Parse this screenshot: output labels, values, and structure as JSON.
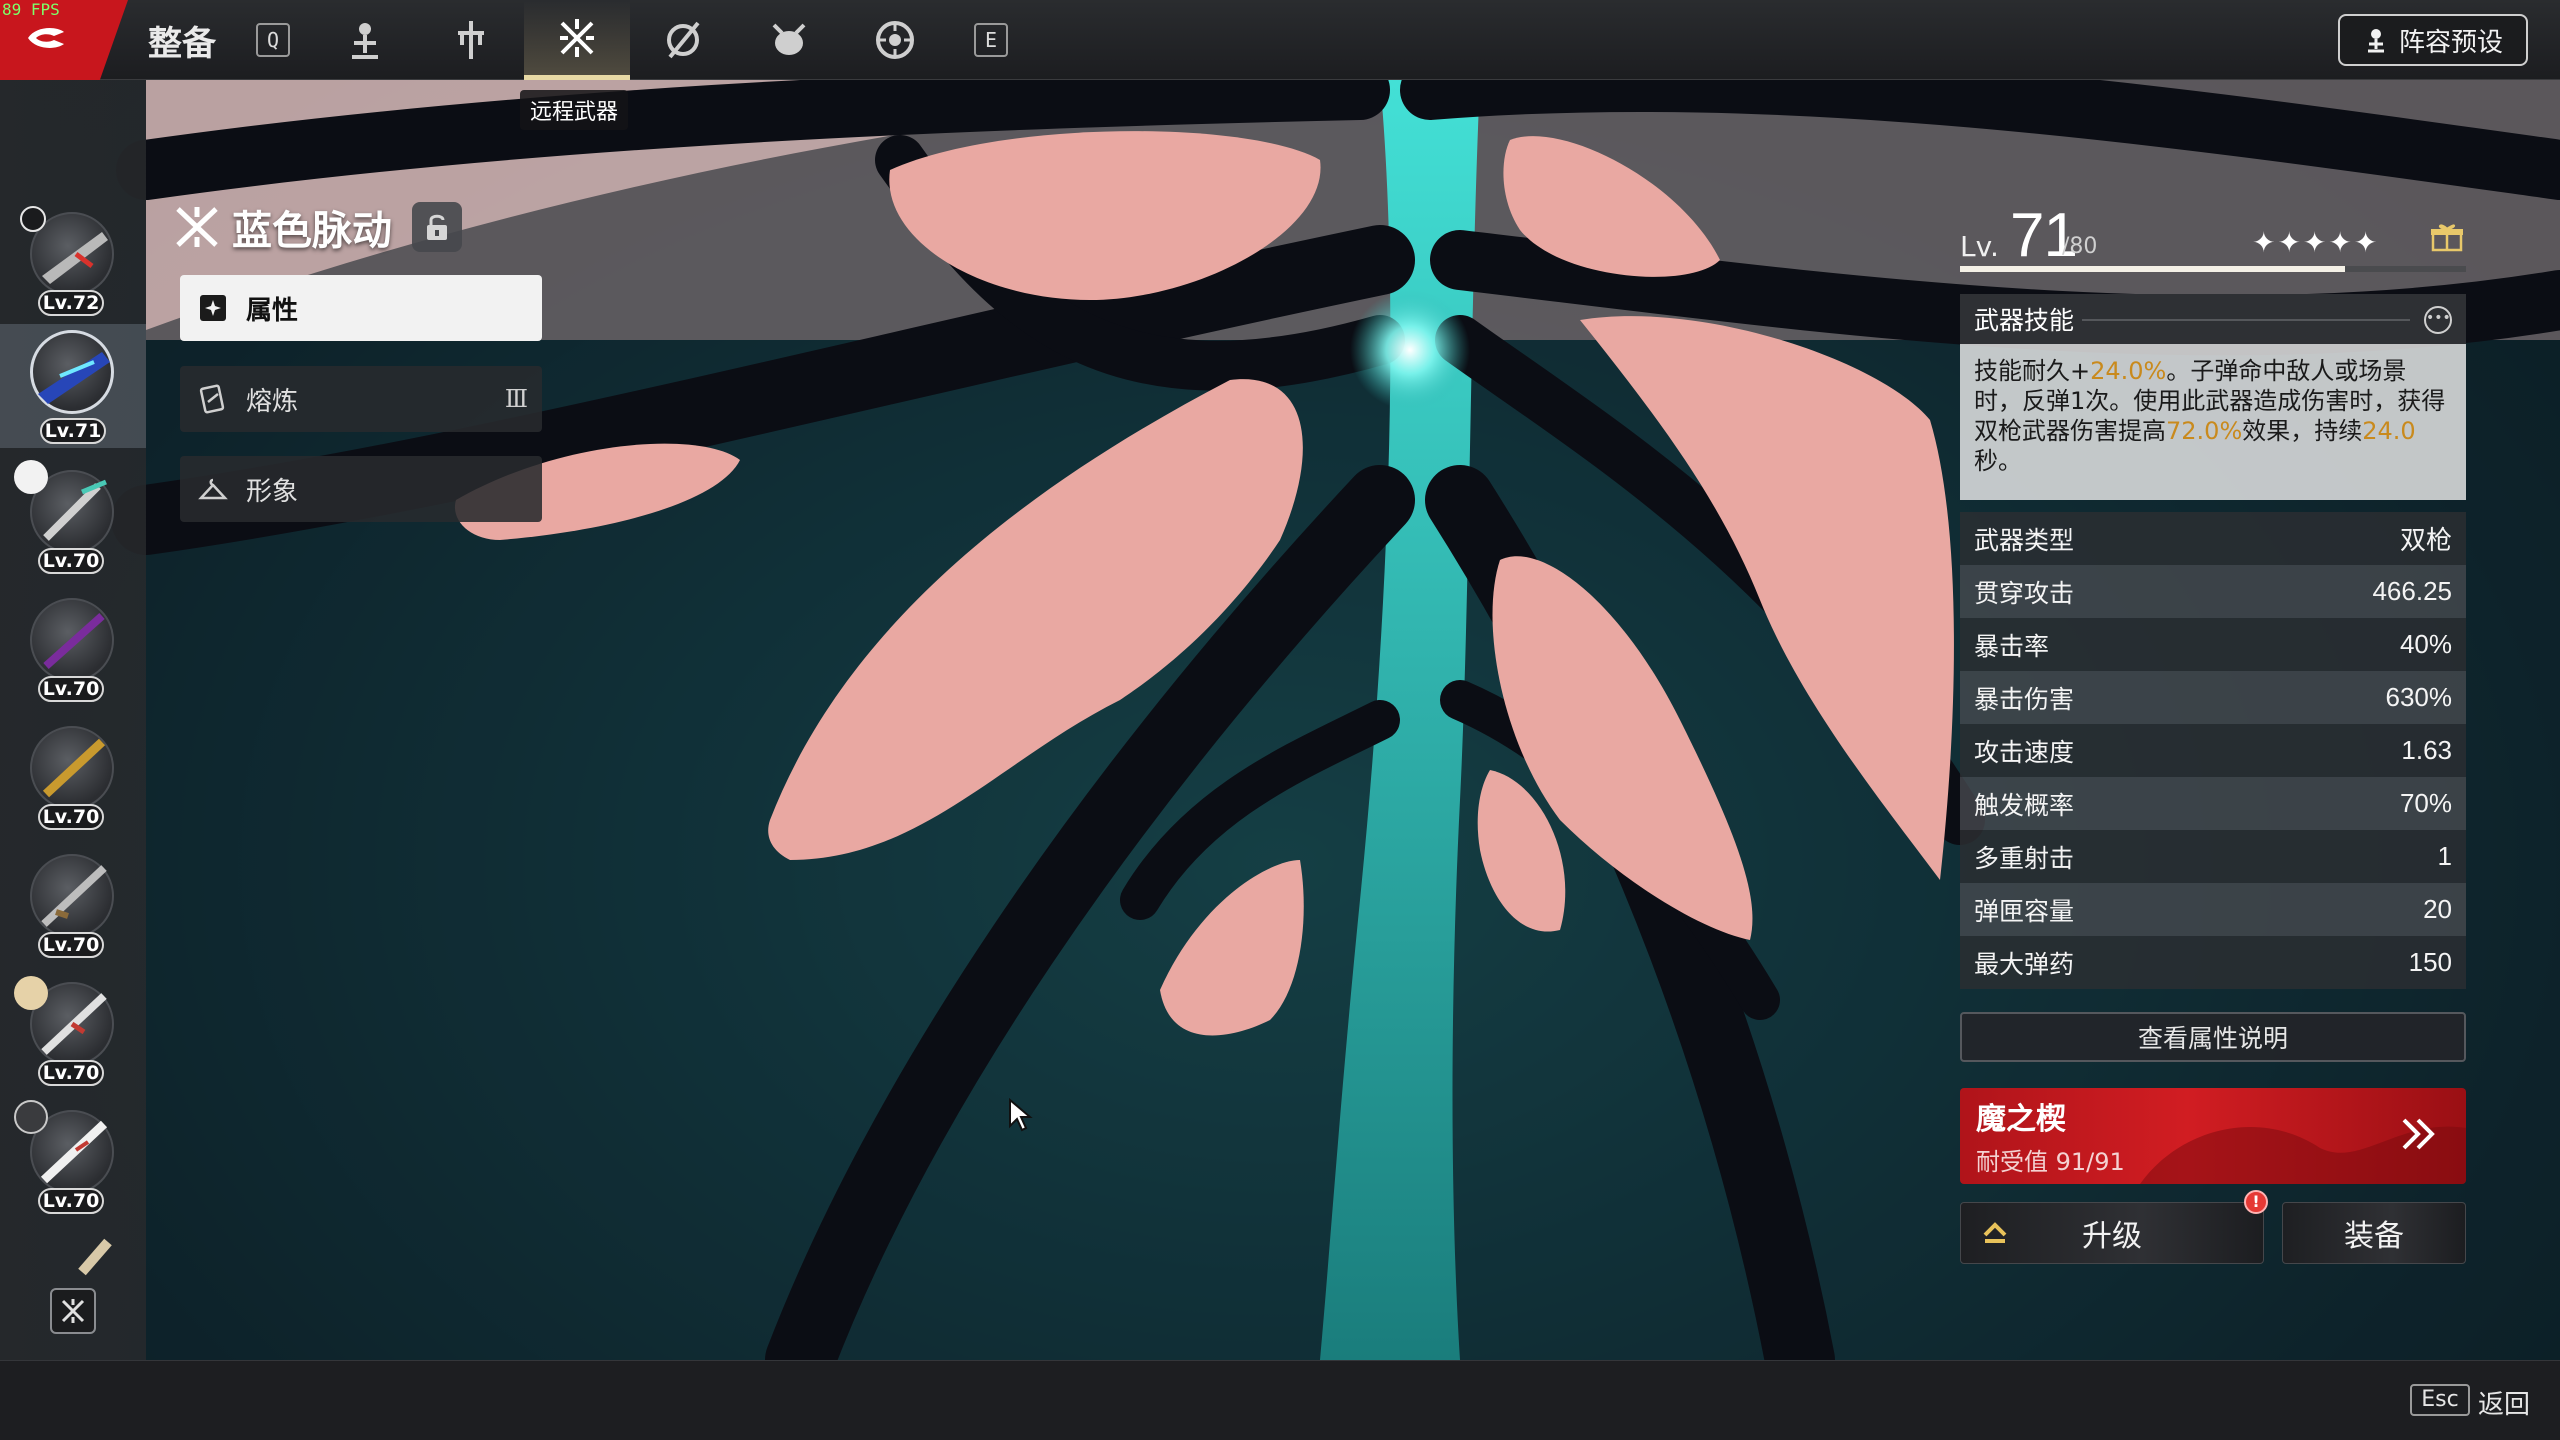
{
  "fps": "89 FPS",
  "topbar": {
    "title": "整备",
    "key_left": "Q",
    "key_right": "E",
    "tabs": [
      {
        "id": "character",
        "icon": "character-icon"
      },
      {
        "id": "melee",
        "icon": "melee-weapon-icon"
      },
      {
        "id": "ranged",
        "icon": "ranged-weapon-icon",
        "active": true
      },
      {
        "id": "consonance",
        "icon": "consonance-weapon-icon"
      },
      {
        "id": "pet",
        "icon": "pet-icon"
      },
      {
        "id": "demon-wedge",
        "icon": "demon-wedge-icon"
      }
    ],
    "active_tab_tooltip": "远程武器",
    "preset_label": "阵容预设"
  },
  "rail": {
    "items": [
      {
        "level": "Lv.72"
      },
      {
        "level": "Lv.71",
        "selected": true
      },
      {
        "level": "Lv.70"
      },
      {
        "level": "Lv.70"
      },
      {
        "level": "Lv.70"
      },
      {
        "level": "Lv.70"
      },
      {
        "level": "Lv.70"
      },
      {
        "level": "Lv.70"
      }
    ]
  },
  "weapon": {
    "name": "蓝色脉动",
    "menu": {
      "attributes": "属性",
      "smelting": "熔炼",
      "smelting_rank": "Ⅲ",
      "appearance": "形象"
    }
  },
  "level": {
    "label": "Lv.",
    "current": "71",
    "max": "/80",
    "progress": 0.76,
    "stars": "✦✦✦✦✦"
  },
  "skill": {
    "title": "武器技能",
    "desc_a": "技能耐久+",
    "desc_b": "24.0%",
    "desc_c": "。子弹命中敌人或场景时，反弹1次。使用此武器造成伤害时，获得双枪武器伤害提高",
    "desc_d": "72.0%",
    "desc_e": "效果，持续",
    "desc_f": "24.0",
    "desc_g": "秒。"
  },
  "stats": [
    {
      "label": "武器类型",
      "value": "双枪"
    },
    {
      "label": "贯穿攻击",
      "value": "466.25"
    },
    {
      "label": "暴击率",
      "value": "40%"
    },
    {
      "label": "暴击伤害",
      "value": "630%"
    },
    {
      "label": "攻击速度",
      "value": "1.63"
    },
    {
      "label": "触发概率",
      "value": "70%"
    },
    {
      "label": "多重射击",
      "value": "1"
    },
    {
      "label": "弹匣容量",
      "value": "20"
    },
    {
      "label": "最大弹药",
      "value": "150"
    }
  ],
  "view_desc_label": "查看属性说明",
  "mod": {
    "name": "魔之楔",
    "durability_label": "耐受值",
    "durability_value": "91/91"
  },
  "actions": {
    "upgrade": "升级",
    "upgrade_badge": "!",
    "equip": "装备"
  },
  "bottom": {
    "esc_key": "Esc",
    "back_label": "返回"
  },
  "colors": {
    "accent_red": "#c8161d",
    "highlight": "#c98a1d",
    "weapon_teal": "#2fb8b4",
    "weapon_pink": "#e9a8a2"
  }
}
